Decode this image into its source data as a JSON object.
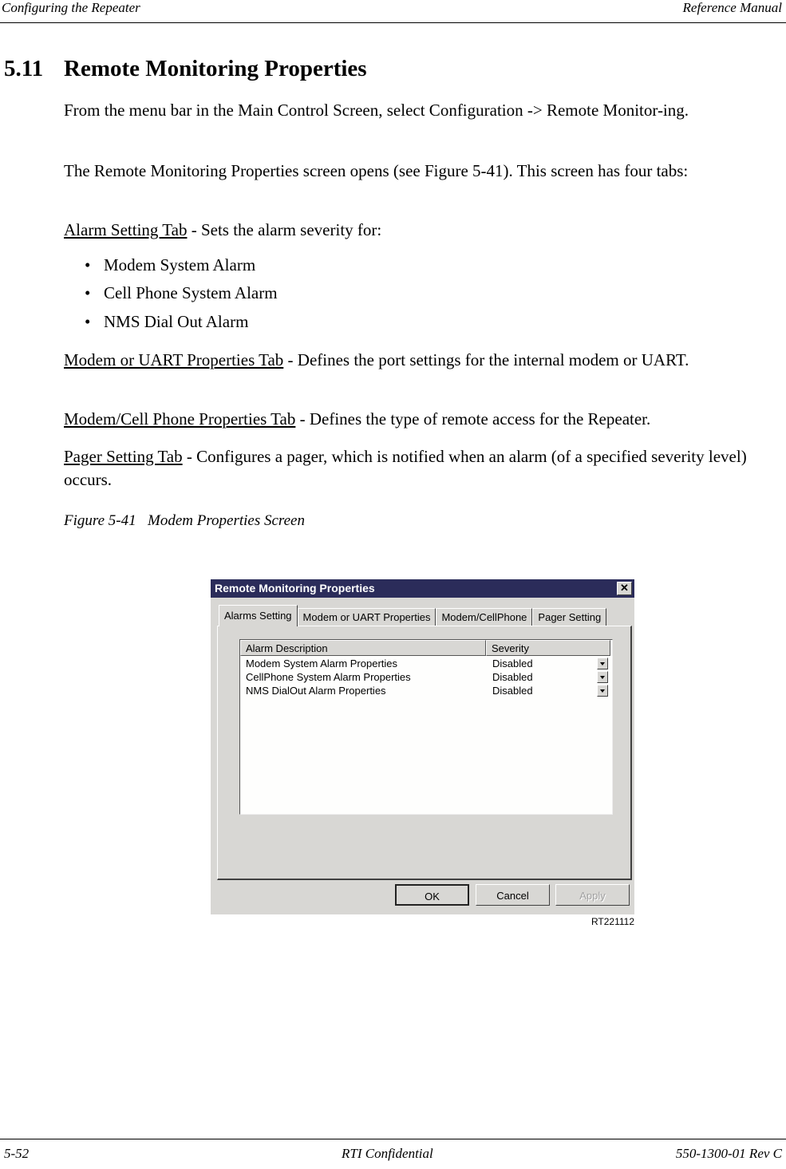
{
  "header": {
    "left": "Configuring the Repeater",
    "right": "Reference Manual"
  },
  "section": {
    "number": "5.11",
    "title": "Remote Monitoring Properties"
  },
  "paragraphs": {
    "p1": "From the menu bar in the Main Control Screen, select Configuration -> Remote Monitor-ing.",
    "p2": "The Remote Monitoring Properties screen opens (see Figure 5-41). This screen has four tabs:",
    "alarm_link": "Alarm Setting Tab",
    "alarm_text": " - Sets the alarm severity for:",
    "bullets": [
      "Modem System Alarm",
      "Cell Phone System Alarm",
      "NMS Dial Out Alarm"
    ],
    "modem_link": "Modem or UART Properties Tab",
    "modem_text": " - Defines the port settings for the internal modem or UART.",
    "cell_link": "Modem/Cell Phone Properties Tab",
    "cell_text": " - Defines the type of remote access for the Repeater.",
    "pager_link": "Pager Setting Tab",
    "pager_text": " - Configures a pager, which is notified when an alarm (of a specified severity level) occurs."
  },
  "figure": {
    "number": "Figure 5-41",
    "caption": "Modem Properties Screen",
    "id": "RT221112"
  },
  "dialog": {
    "title": "Remote Monitoring Properties",
    "close_glyph": "✕",
    "tabs": [
      "Alarms Setting",
      "Modem or UART Properties",
      "Modem/CellPhone",
      "Pager Setting"
    ],
    "active_tab": "Alarms Setting",
    "columns": [
      "Alarm Description",
      "Severity"
    ],
    "rows": [
      {
        "description": "Modem System Alarm Properties",
        "severity": "Disabled"
      },
      {
        "description": "CellPhone System Alarm Properties",
        "severity": "Disabled"
      },
      {
        "description": "NMS DialOut Alarm Properties",
        "severity": "Disabled"
      }
    ],
    "buttons": {
      "ok": "OK",
      "cancel": "Cancel",
      "apply": "Apply"
    },
    "colors": {
      "titlebar": "#2b2c5a",
      "face": "#d8d7d4"
    }
  },
  "footer": {
    "left": "5-52",
    "center": "RTI Confidential",
    "right": "550-1300-01 Rev C"
  }
}
